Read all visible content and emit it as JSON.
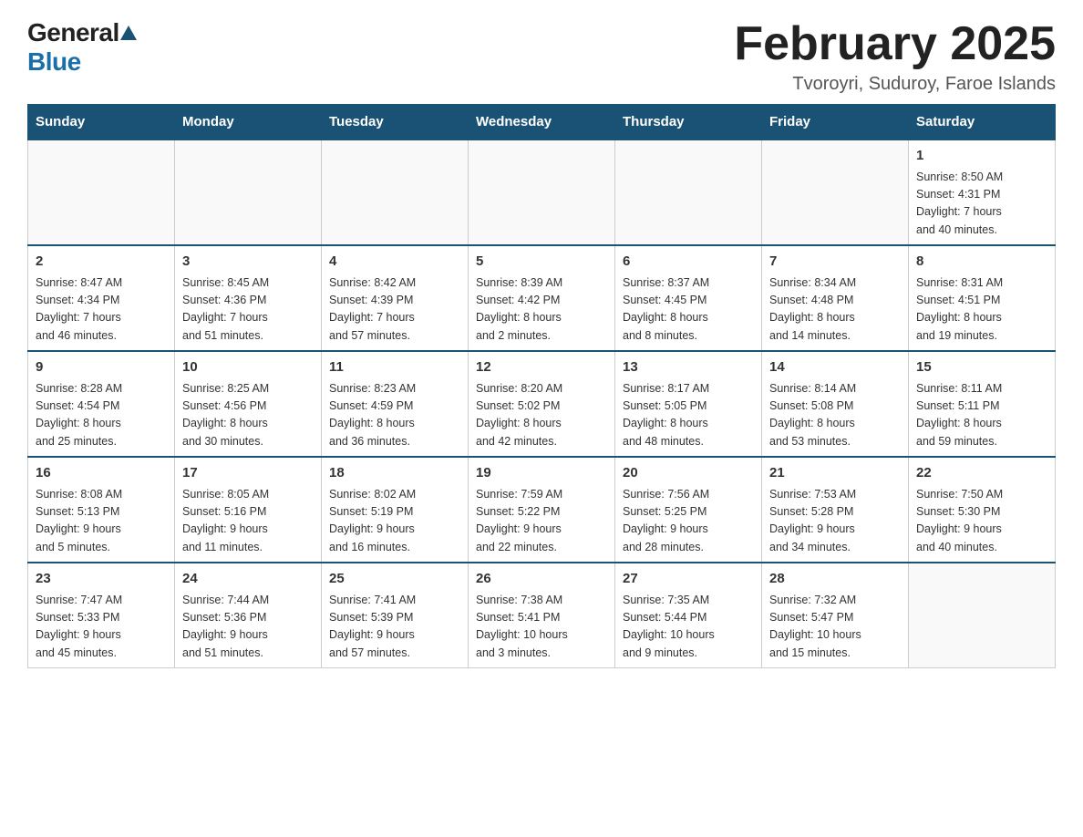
{
  "header": {
    "logo_general": "General",
    "logo_blue": "Blue",
    "title": "February 2025",
    "subtitle": "Tvoroyri, Suduroy, Faroe Islands"
  },
  "days_of_week": [
    "Sunday",
    "Monday",
    "Tuesday",
    "Wednesday",
    "Thursday",
    "Friday",
    "Saturday"
  ],
  "weeks": [
    [
      {
        "day": "",
        "info": ""
      },
      {
        "day": "",
        "info": ""
      },
      {
        "day": "",
        "info": ""
      },
      {
        "day": "",
        "info": ""
      },
      {
        "day": "",
        "info": ""
      },
      {
        "day": "",
        "info": ""
      },
      {
        "day": "1",
        "info": "Sunrise: 8:50 AM\nSunset: 4:31 PM\nDaylight: 7 hours\nand 40 minutes."
      }
    ],
    [
      {
        "day": "2",
        "info": "Sunrise: 8:47 AM\nSunset: 4:34 PM\nDaylight: 7 hours\nand 46 minutes."
      },
      {
        "day": "3",
        "info": "Sunrise: 8:45 AM\nSunset: 4:36 PM\nDaylight: 7 hours\nand 51 minutes."
      },
      {
        "day": "4",
        "info": "Sunrise: 8:42 AM\nSunset: 4:39 PM\nDaylight: 7 hours\nand 57 minutes."
      },
      {
        "day": "5",
        "info": "Sunrise: 8:39 AM\nSunset: 4:42 PM\nDaylight: 8 hours\nand 2 minutes."
      },
      {
        "day": "6",
        "info": "Sunrise: 8:37 AM\nSunset: 4:45 PM\nDaylight: 8 hours\nand 8 minutes."
      },
      {
        "day": "7",
        "info": "Sunrise: 8:34 AM\nSunset: 4:48 PM\nDaylight: 8 hours\nand 14 minutes."
      },
      {
        "day": "8",
        "info": "Sunrise: 8:31 AM\nSunset: 4:51 PM\nDaylight: 8 hours\nand 19 minutes."
      }
    ],
    [
      {
        "day": "9",
        "info": "Sunrise: 8:28 AM\nSunset: 4:54 PM\nDaylight: 8 hours\nand 25 minutes."
      },
      {
        "day": "10",
        "info": "Sunrise: 8:25 AM\nSunset: 4:56 PM\nDaylight: 8 hours\nand 30 minutes."
      },
      {
        "day": "11",
        "info": "Sunrise: 8:23 AM\nSunset: 4:59 PM\nDaylight: 8 hours\nand 36 minutes."
      },
      {
        "day": "12",
        "info": "Sunrise: 8:20 AM\nSunset: 5:02 PM\nDaylight: 8 hours\nand 42 minutes."
      },
      {
        "day": "13",
        "info": "Sunrise: 8:17 AM\nSunset: 5:05 PM\nDaylight: 8 hours\nand 48 minutes."
      },
      {
        "day": "14",
        "info": "Sunrise: 8:14 AM\nSunset: 5:08 PM\nDaylight: 8 hours\nand 53 minutes."
      },
      {
        "day": "15",
        "info": "Sunrise: 8:11 AM\nSunset: 5:11 PM\nDaylight: 8 hours\nand 59 minutes."
      }
    ],
    [
      {
        "day": "16",
        "info": "Sunrise: 8:08 AM\nSunset: 5:13 PM\nDaylight: 9 hours\nand 5 minutes."
      },
      {
        "day": "17",
        "info": "Sunrise: 8:05 AM\nSunset: 5:16 PM\nDaylight: 9 hours\nand 11 minutes."
      },
      {
        "day": "18",
        "info": "Sunrise: 8:02 AM\nSunset: 5:19 PM\nDaylight: 9 hours\nand 16 minutes."
      },
      {
        "day": "19",
        "info": "Sunrise: 7:59 AM\nSunset: 5:22 PM\nDaylight: 9 hours\nand 22 minutes."
      },
      {
        "day": "20",
        "info": "Sunrise: 7:56 AM\nSunset: 5:25 PM\nDaylight: 9 hours\nand 28 minutes."
      },
      {
        "day": "21",
        "info": "Sunrise: 7:53 AM\nSunset: 5:28 PM\nDaylight: 9 hours\nand 34 minutes."
      },
      {
        "day": "22",
        "info": "Sunrise: 7:50 AM\nSunset: 5:30 PM\nDaylight: 9 hours\nand 40 minutes."
      }
    ],
    [
      {
        "day": "23",
        "info": "Sunrise: 7:47 AM\nSunset: 5:33 PM\nDaylight: 9 hours\nand 45 minutes."
      },
      {
        "day": "24",
        "info": "Sunrise: 7:44 AM\nSunset: 5:36 PM\nDaylight: 9 hours\nand 51 minutes."
      },
      {
        "day": "25",
        "info": "Sunrise: 7:41 AM\nSunset: 5:39 PM\nDaylight: 9 hours\nand 57 minutes."
      },
      {
        "day": "26",
        "info": "Sunrise: 7:38 AM\nSunset: 5:41 PM\nDaylight: 10 hours\nand 3 minutes."
      },
      {
        "day": "27",
        "info": "Sunrise: 7:35 AM\nSunset: 5:44 PM\nDaylight: 10 hours\nand 9 minutes."
      },
      {
        "day": "28",
        "info": "Sunrise: 7:32 AM\nSunset: 5:47 PM\nDaylight: 10 hours\nand 15 minutes."
      },
      {
        "day": "",
        "info": ""
      }
    ]
  ],
  "colors": {
    "header_bg": "#1a5276",
    "header_text": "#ffffff",
    "border": "#aab",
    "logo_dark": "#222",
    "logo_blue": "#1a6fa8",
    "triangle": "#1a5276"
  }
}
